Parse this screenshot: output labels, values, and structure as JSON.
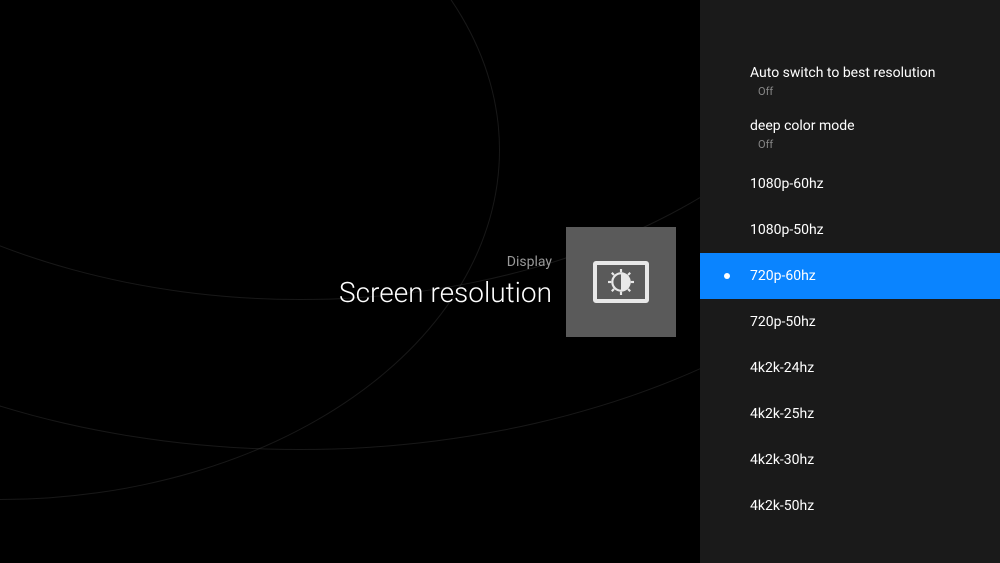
{
  "header": {
    "category": "Display",
    "title": "Screen resolution"
  },
  "settings": [
    {
      "type": "toggle",
      "label": "Auto switch to best resolution",
      "value": "Off",
      "selected": false
    },
    {
      "type": "toggle",
      "label": "deep color mode",
      "value": "Off",
      "selected": false
    }
  ],
  "resolutions": [
    {
      "label": "1080p-60hz",
      "selected": false
    },
    {
      "label": "1080p-50hz",
      "selected": false
    },
    {
      "label": "720p-60hz",
      "selected": true
    },
    {
      "label": "720p-50hz",
      "selected": false
    },
    {
      "label": "4k2k-24hz",
      "selected": false
    },
    {
      "label": "4k2k-25hz",
      "selected": false
    },
    {
      "label": "4k2k-30hz",
      "selected": false
    },
    {
      "label": "4k2k-50hz",
      "selected": false
    }
  ],
  "colors": {
    "accent": "#0a84ff",
    "panel": "#1a1a1a",
    "background": "#000000"
  }
}
